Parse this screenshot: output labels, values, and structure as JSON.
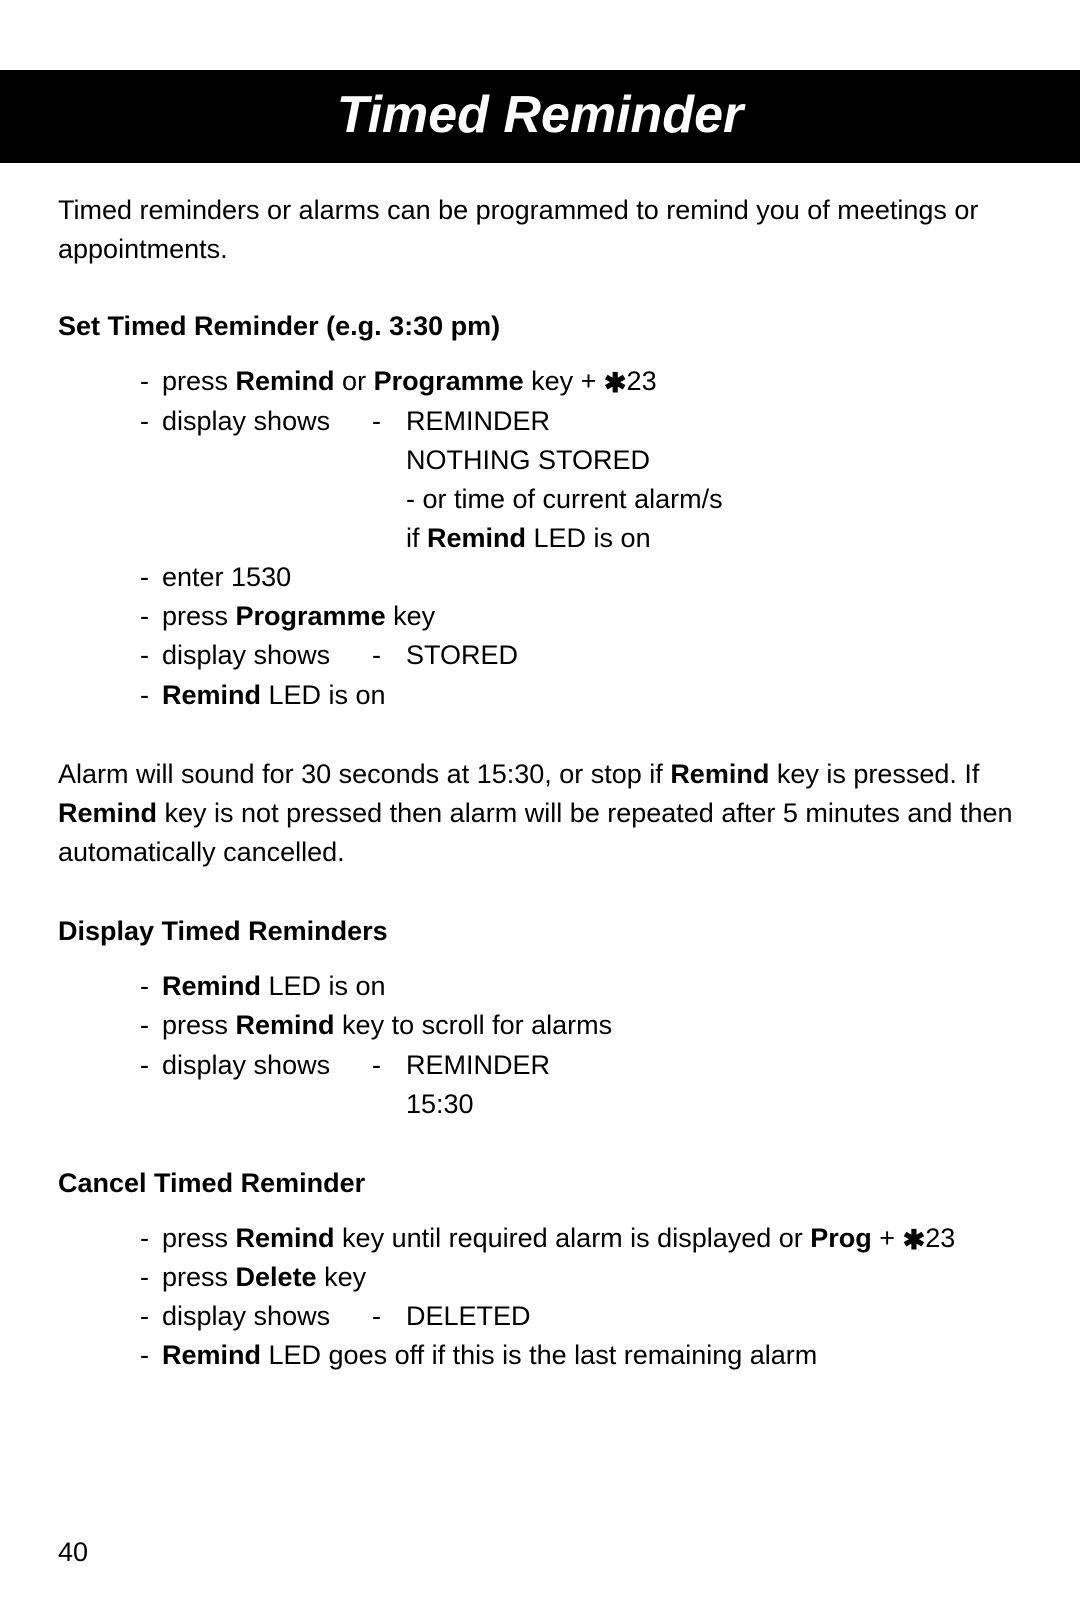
{
  "title": "Timed Reminder",
  "intro": "Timed reminders or alarms can be programmed to remind you of meetings or appointments.",
  "section1": {
    "heading": "Set Timed Reminder (e.g. 3:30 pm)",
    "step1_prefix": "press ",
    "step1_b1": "Remind",
    "step1_mid": " or ",
    "step1_b2": "Programme",
    "step1_after": " key + ",
    "step1_code": "23",
    "step2_label": "display shows",
    "step2_val1": "REMINDER",
    "step2_val2": "NOTHING STORED",
    "step2_val3": "- or time of current alarm/s",
    "step2_val4_pre": "if ",
    "step2_val4_b": "Remind",
    "step2_val4_post": " LED is on",
    "step3": "enter 1530",
    "step4_pre": "press ",
    "step4_b": "Programme",
    "step4_post": " key",
    "step5_label": "display shows",
    "step5_val": "STORED",
    "step6_b": "Remind",
    "step6_post": " LED is on"
  },
  "para1_a": "Alarm will sound for 30 seconds at 15:30, or stop if ",
  "para1_b": "Remind",
  "para1_c": " key is pressed. If ",
  "para1_d": "Remind",
  "para1_e": " key is not pressed then alarm will be repeated after 5 minutes and then automatically cancelled.",
  "section2": {
    "heading": "Display Timed Reminders",
    "step1_b": "Remind",
    "step1_post": " LED is on",
    "step2_pre": "press ",
    "step2_b": "Remind",
    "step2_post": " key to scroll for alarms",
    "step3_label": "display shows",
    "step3_val1": "REMINDER",
    "step3_val2": "15:30"
  },
  "section3": {
    "heading": "Cancel Timed Reminder",
    "step1_pre": "press ",
    "step1_b1": "Remind",
    "step1_mid": " key until required alarm is displayed or ",
    "step1_b2": "Prog",
    "step1_after": " + ",
    "step1_code": "23",
    "step2_pre": "press ",
    "step2_b": "Delete",
    "step2_post": " key",
    "step3_label": "display shows",
    "step3_val": "DELETED",
    "step4_b": "Remind",
    "step4_post": " LED goes off if this is the last remaining alarm"
  },
  "page_number": "40"
}
